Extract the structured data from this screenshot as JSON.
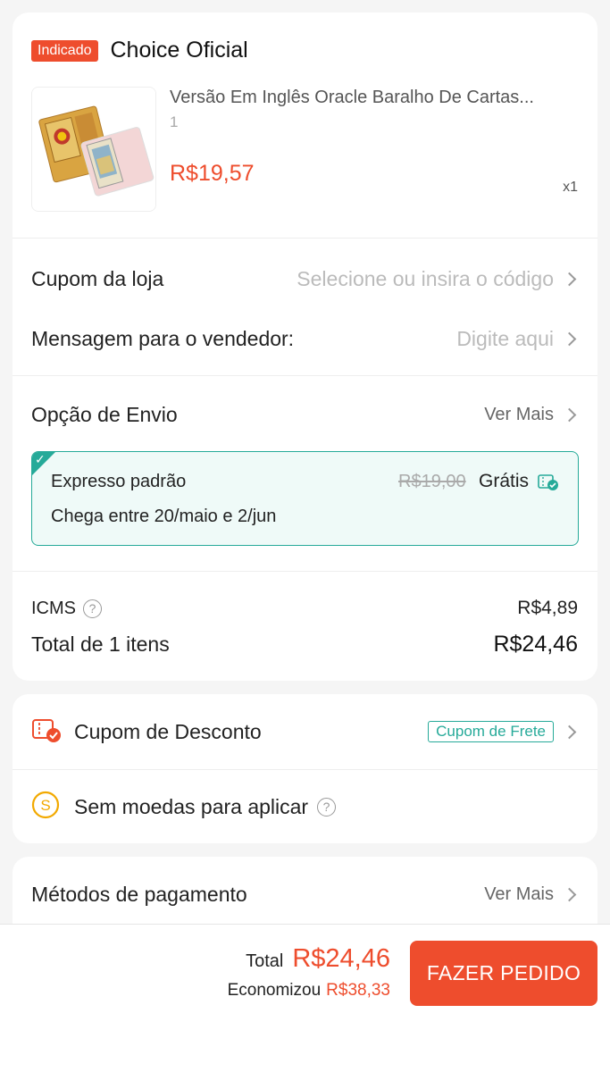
{
  "order": {
    "badge": "Indicado",
    "shop_name": "Choice Oficial",
    "product": {
      "title": "Versão Em Inglês Oracle Baralho De Cartas...",
      "variant": "1",
      "price": "R$19,57",
      "quantity": "x1"
    },
    "store_coupon": {
      "label": "Cupom da loja",
      "placeholder": "Selecione ou insira o código"
    },
    "seller_message": {
      "label": "Mensagem para o vendedor:",
      "placeholder": "Digite aqui"
    },
    "shipping": {
      "title": "Opção de Envio",
      "see_more": "Ver Mais",
      "option_name": "Expresso padrão",
      "old_price": "R$19,00",
      "price": "Grátis",
      "eta": "Chega entre 20/maio e 2/jun"
    },
    "icms": {
      "label": "ICMS",
      "value": "R$4,89"
    },
    "total": {
      "label": "Total de 1 itens",
      "value": "R$24,46"
    }
  },
  "coupons": {
    "discount_label": "Cupom de Desconto",
    "free_shipping_tag": "Cupom de Frete",
    "coins_label": "Sem moedas para aplicar"
  },
  "payment": {
    "title": "Métodos de pagamento",
    "see_more": "Ver Mais"
  },
  "footer": {
    "total_label": "Total",
    "total_value": "R$24,46",
    "saved_label": "Economizou",
    "saved_value": "R$38,33",
    "order_button": "FAZER PEDIDO"
  },
  "colors": {
    "accent": "#ee4d2d",
    "teal": "#26aa99",
    "coin": "#f2a900"
  }
}
